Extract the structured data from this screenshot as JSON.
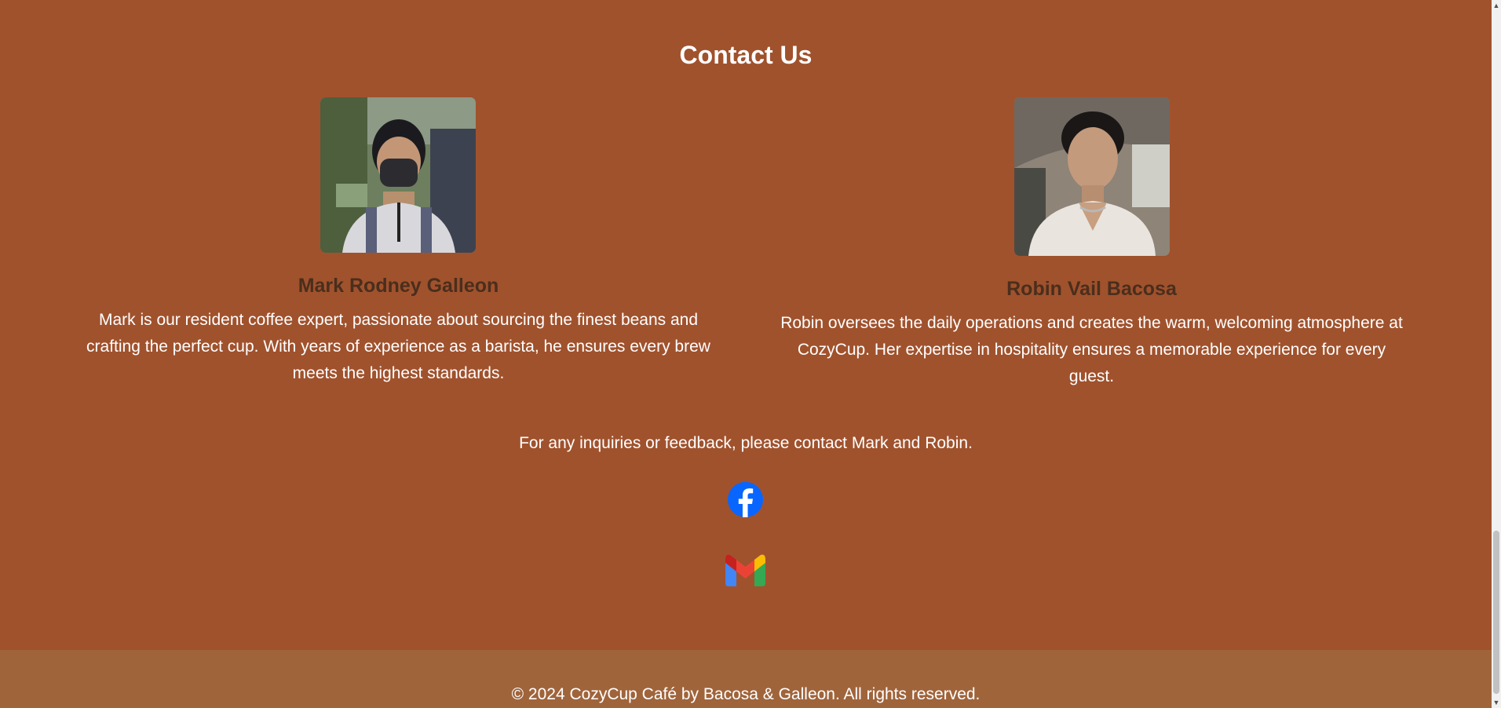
{
  "contact": {
    "title": "Contact Us",
    "people": [
      {
        "name": "Mark Rodney Galleon",
        "bio": "Mark is our resident coffee expert, passionate about sourcing the finest beans and crafting the perfect cup. With years of experience as a barista, he ensures every brew meets the highest standards."
      },
      {
        "name": "Robin Vail Bacosa",
        "bio": "Robin oversees the daily operations and creates the warm, welcoming atmosphere at CozyCup. Her expertise in hospitality ensures a memorable experience for every guest."
      }
    ],
    "inquiry": "For any inquiries or feedback, please contact Mark and Robin.",
    "social_icons": [
      "facebook-icon",
      "gmail-icon"
    ]
  },
  "footer": {
    "text": "© 2024 CozyCup Café by Bacosa & Galleon. All rights reserved."
  },
  "colors": {
    "background": "#a0522d",
    "footer_background": "#a0643b",
    "name_text": "#4a2e1c",
    "body_text": "#ffffff",
    "facebook_blue": "#0866ff"
  }
}
